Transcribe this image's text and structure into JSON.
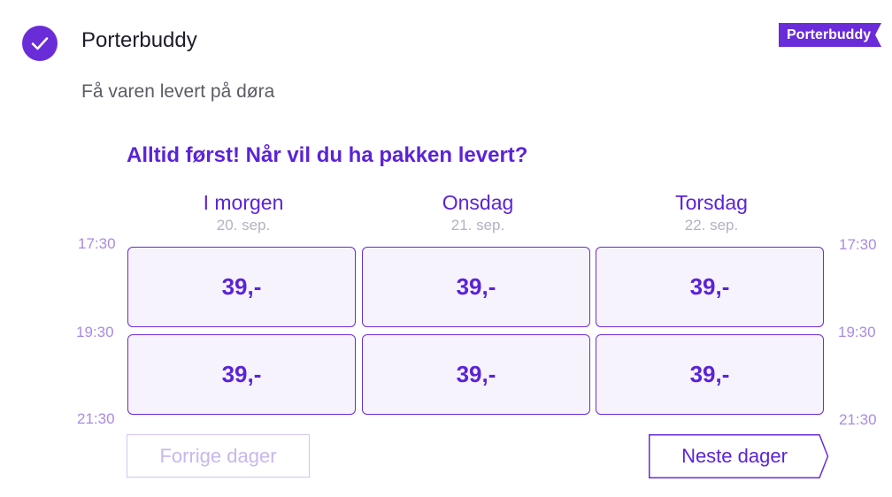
{
  "option": {
    "title": "Porterbuddy",
    "subtitle": "Få varen levert på døra",
    "badge": "Porterbuddy",
    "selected_icon": "check-icon",
    "accent_color": "#6a2bd9"
  },
  "delivery": {
    "headline": "Alltid først! Når vil du ha pakken levert?",
    "days": [
      {
        "name": "I morgen",
        "date": "20. sep."
      },
      {
        "name": "Onsdag",
        "date": "21. sep."
      },
      {
        "name": "Torsdag",
        "date": "22. sep."
      }
    ],
    "times": [
      "17:30",
      "19:30",
      "21:30"
    ],
    "slots": [
      [
        "39,-",
        "39,-",
        "39,-"
      ],
      [
        "39,-",
        "39,-",
        "39,-"
      ]
    ],
    "prev_label": "Forrige dager",
    "next_label": "Neste dager"
  }
}
